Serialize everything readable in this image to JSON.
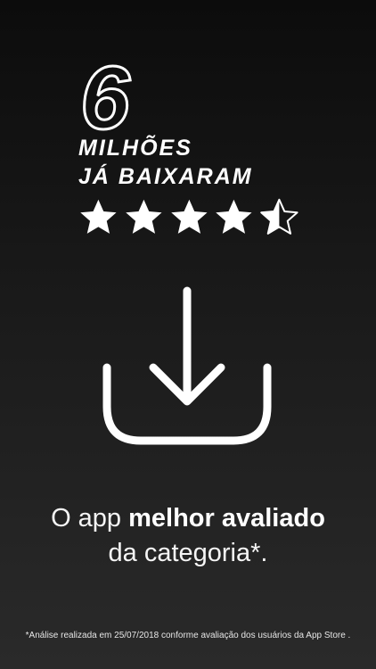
{
  "badge": {
    "number": "6",
    "line1": "MILHÕES",
    "line2": "JÁ BAIXARAM",
    "rating": 4.5
  },
  "stars": [
    {
      "icon": "star-full-icon"
    },
    {
      "icon": "star-full-icon"
    },
    {
      "icon": "star-full-icon"
    },
    {
      "icon": "star-full-icon"
    },
    {
      "icon": "star-half-icon"
    }
  ],
  "download_icon": "download-tray-icon",
  "tagline": {
    "prefix": "O app ",
    "emphasis": "melhor avaliado",
    "line2": "da categoria*."
  },
  "disclaimer": "*Análise realizada em 25/07/2018 conforme avaliação dos usuários da App Store .",
  "colors": {
    "background_top": "#0c0c0c",
    "background_bottom": "#2a2a2a",
    "foreground": "#ffffff"
  }
}
